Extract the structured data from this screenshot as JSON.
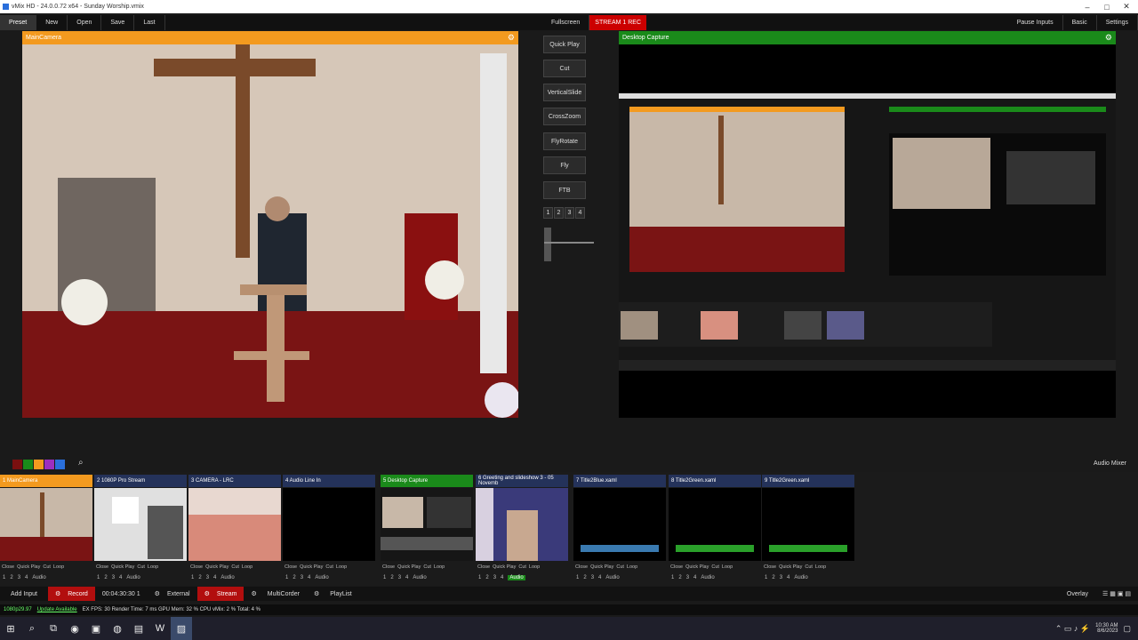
{
  "window": {
    "title": "vMix HD - 24.0.0.72 x64 - Sunday Worship.vmix",
    "minimize": "–",
    "maximize": "□",
    "close": "✕"
  },
  "menu": {
    "items": [
      "Preset",
      "New",
      "Open",
      "Save",
      "Last"
    ],
    "fullscreen": "Fullscreen",
    "stream_rec": "STREAM 1 REC",
    "right_items": [
      "Pause Inputs",
      "Basic",
      "Settings"
    ]
  },
  "preview": {
    "title": "MainCamera"
  },
  "output": {
    "title": "Desktop Capture"
  },
  "transitions": {
    "quick_play": "Quick Play",
    "cut": "Cut",
    "buttons": [
      "VerticalSlide",
      "CrossZoom",
      "FlyRotate",
      "Fly"
    ],
    "ftb": "FTB",
    "numbers": [
      "1",
      "2",
      "3",
      "4"
    ]
  },
  "inputs": [
    {
      "label": "1  MainCamera",
      "status": "preview"
    },
    {
      "label": "2  1080P Pro Stream",
      "status": "none"
    },
    {
      "label": "3  CAMERA - LRC",
      "status": "none"
    },
    {
      "label": "4  Audio Line In",
      "status": "none"
    },
    {
      "label": "5  Desktop Capture",
      "status": "active"
    },
    {
      "label": "6  Greeting and slideshow 3 - 05 Novemb",
      "status": "none"
    },
    {
      "label": "7  Title2Blue.xaml",
      "status": "none"
    },
    {
      "label": "8  Title2Green.xaml",
      "status": "none"
    },
    {
      "label": "9  Title2Green.xaml",
      "status": "none"
    }
  ],
  "input_controls": [
    "Close",
    "Quick Play",
    "Cut",
    "Loop"
  ],
  "input_numbers": [
    "1",
    "2",
    "3",
    "4",
    "Audio"
  ],
  "audio_mixer": "Audio Mixer",
  "bottombar": {
    "add_input": "Add Input",
    "record": "Record",
    "timecode": "00:04:30:30 1",
    "external": "External",
    "stream": "Stream",
    "multicorder": "MultiCorder",
    "playlist": "PlayList",
    "overlay": "Overlay"
  },
  "status": {
    "res": "1080p29.97",
    "update": "Update Available",
    "stats": "EX FPS: 30  Render Time: 7 ms  GPU Mem: 32 %  CPU vMix: 2 %  Total: 4 %"
  },
  "clock": {
    "time": "10:30 AM",
    "date": "8/6/2023"
  },
  "colors": {
    "preview_accent": "#f39a1f",
    "output_accent": "#1a8a1a",
    "record_red": "#b20e0e",
    "input_header": "#24325a"
  }
}
